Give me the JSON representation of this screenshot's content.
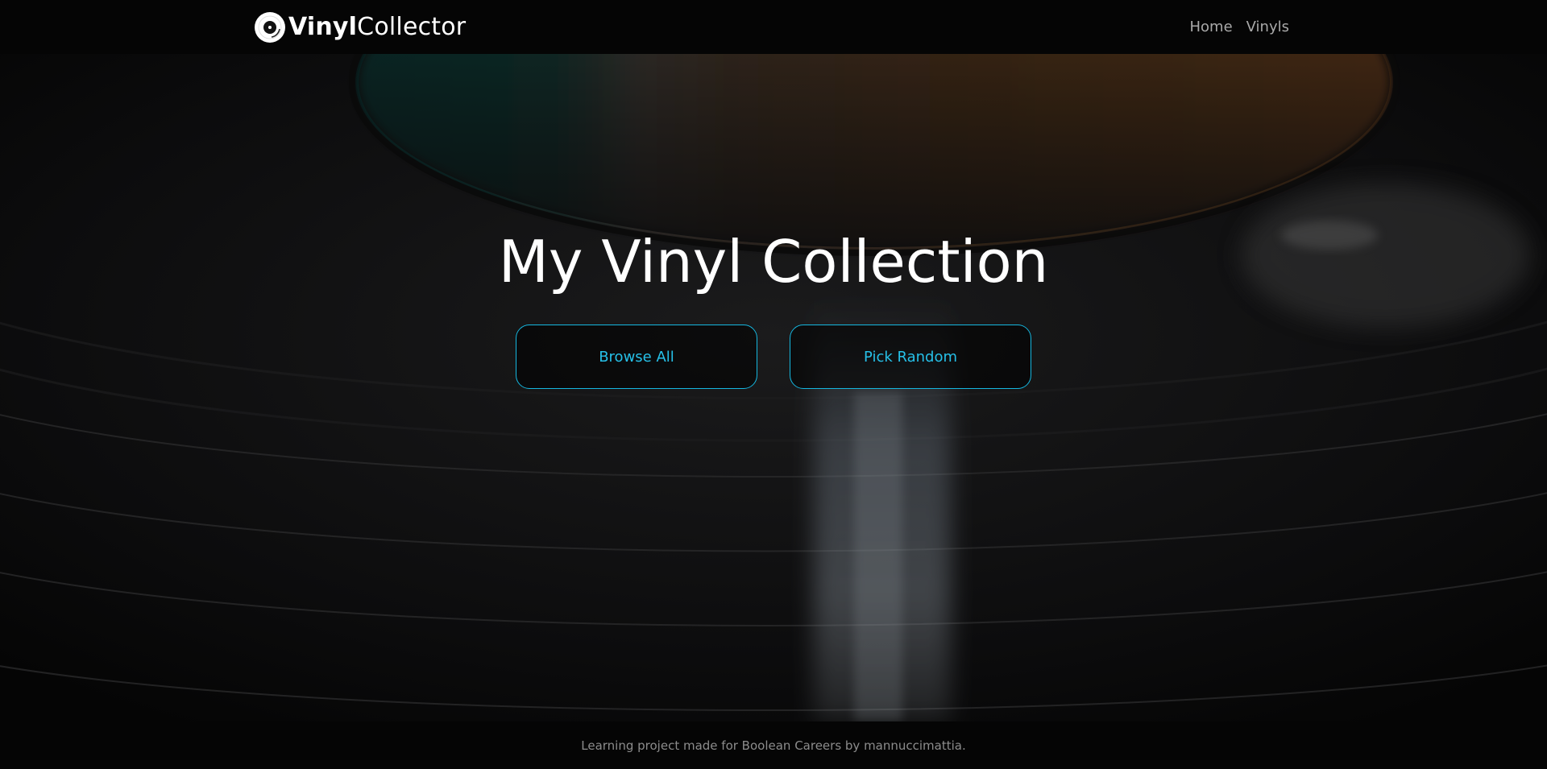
{
  "header": {
    "brand_bold": "Vinyl",
    "brand_light": "Collector",
    "nav": [
      {
        "label": "Home"
      },
      {
        "label": "Vinyls"
      }
    ]
  },
  "hero": {
    "title": "My Vinyl Collection",
    "browse_label": "Browse All",
    "random_label": "Pick Random"
  },
  "footer": {
    "text": "Learning project made for Boolean Careers by mannuccimattia."
  },
  "colors": {
    "accent": "#26c0e8",
    "header_bg": "#050505",
    "nav_text": "#a9a9a9"
  },
  "icons": {
    "logo": "vinyl-record-icon"
  }
}
